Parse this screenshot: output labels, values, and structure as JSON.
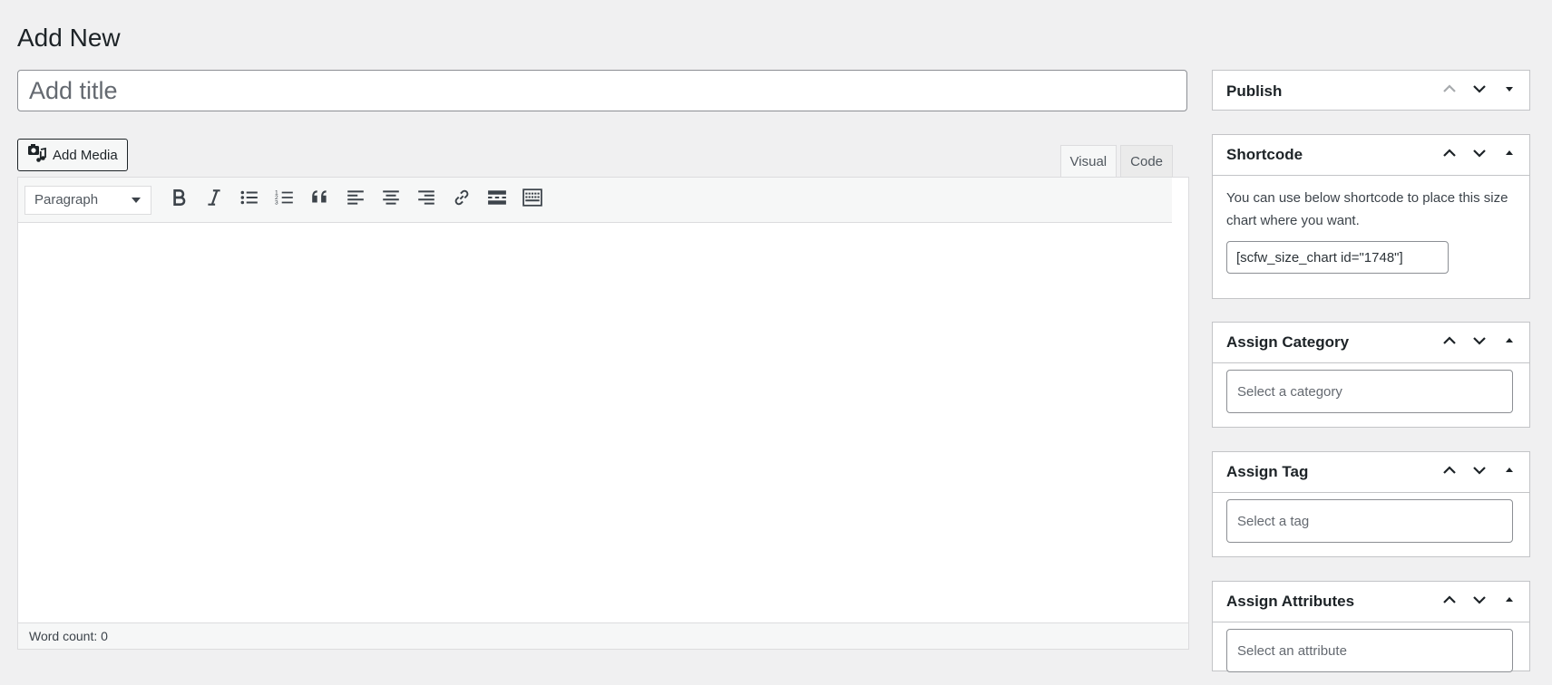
{
  "page": {
    "title": "Add New"
  },
  "title_field": {
    "placeholder": "Add title",
    "value": ""
  },
  "editor": {
    "add_media_label": "Add Media",
    "tabs": [
      {
        "label": "Visual",
        "active": true
      },
      {
        "label": "Code",
        "active": false
      }
    ],
    "format_select": {
      "value": "Paragraph"
    },
    "toolbar_buttons": [
      "bold-icon",
      "italic-icon",
      "bullet-list-icon",
      "numbered-list-icon",
      "blockquote-icon",
      "align-left-icon",
      "align-center-icon",
      "align-right-icon",
      "link-icon",
      "read-more-icon",
      "toolbar-toggle-icon"
    ],
    "word_count": "Word count: 0"
  },
  "sidebar": {
    "publish": {
      "title": "Publish"
    },
    "shortcode": {
      "title": "Shortcode",
      "description": "You can use below shortcode to place this size chart where you want.",
      "value": "[scfw_size_chart id=\"1748\"]"
    },
    "category": {
      "title": "Assign Category",
      "placeholder": "Select a category"
    },
    "tag": {
      "title": "Assign Tag",
      "placeholder": "Select a tag"
    },
    "attributes": {
      "title": "Assign Attributes",
      "placeholder": "Select an attribute"
    }
  }
}
